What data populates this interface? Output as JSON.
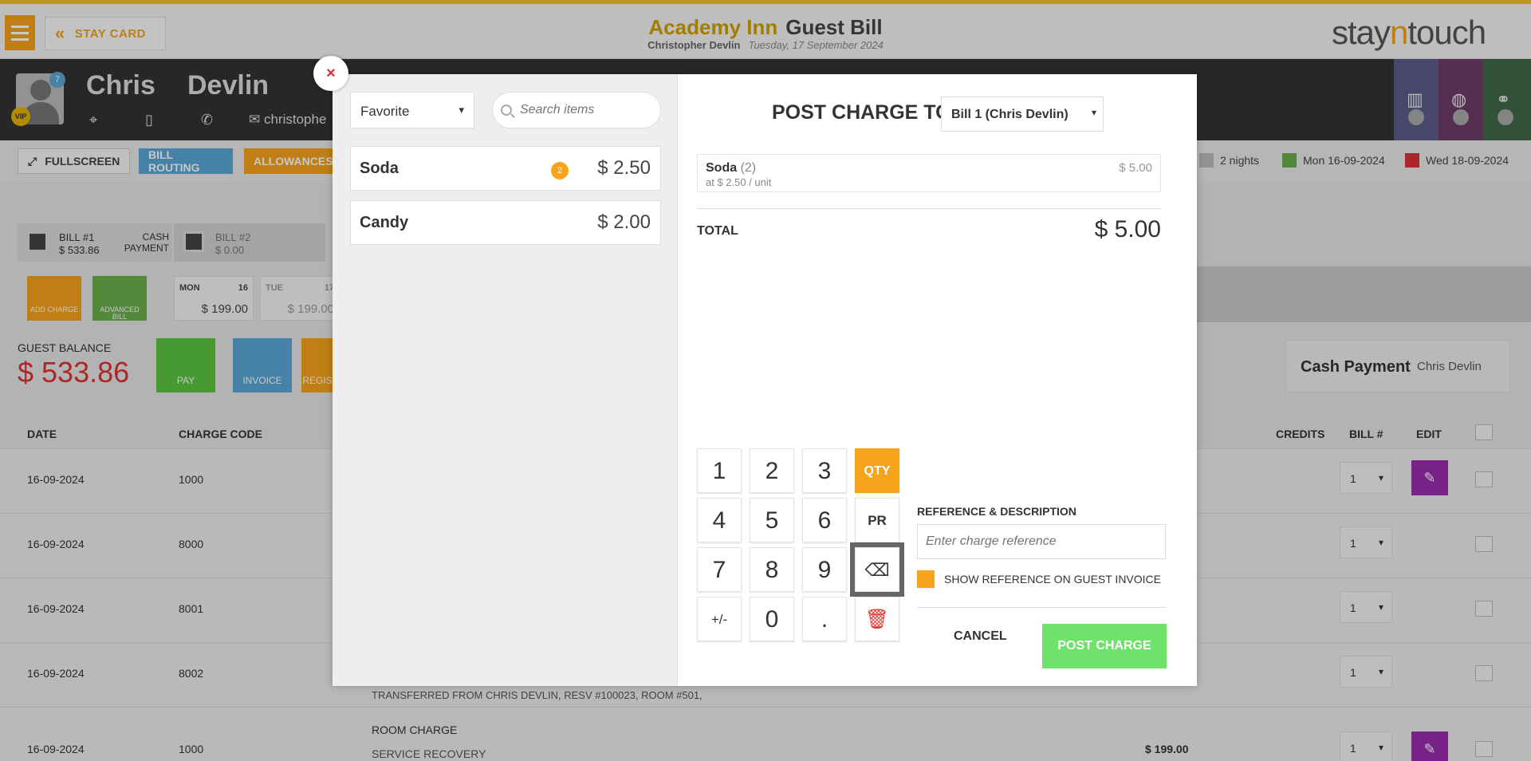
{
  "header": {
    "stay_card": "STAY CARD",
    "hotel": "Academy Inn",
    "page_title": "Guest Bill",
    "guest": "Christopher Devlin",
    "date": "Tuesday, 17 September 2024",
    "brand_a": "stay",
    "brand_b": "n",
    "brand_c": "touch"
  },
  "guest": {
    "first": "Chris",
    "last": "Devlin",
    "badge": "7",
    "vip": "VIP",
    "email": "christophe"
  },
  "actions": {
    "fullscreen": "FULLSCREEN",
    "routing": "BILL ROUTING",
    "allowances": "ALLOWANCES",
    "nights": "2 nights",
    "arrival": "Mon 16-09-2024",
    "departure": "Wed 18-09-2024"
  },
  "bills": {
    "bill1_title": "BILL #1",
    "bill1_amount": "$ 533.86",
    "cash_payment": "CASH PAYMENT",
    "bill2_title": "BILL #2",
    "bill2_amount": "$ 0.00",
    "add_charge": "ADD CHARGE",
    "advanced_bill": "ADVANCED BILL",
    "day1": {
      "day": "MON",
      "num": "16",
      "amount": "$ 199.00"
    },
    "day2": {
      "day": "TUE",
      "num": "17",
      "amount": "$ 199.00"
    },
    "guest_balance_label": "GUEST BALANCE",
    "guest_balance": "$ 533.86",
    "pay": "PAY",
    "invoice": "INVOICE",
    "register": "REGIS",
    "payment_type": "Cash Payment",
    "payer": "Chris Devlin"
  },
  "table": {
    "headers": {
      "date": "DATE",
      "code": "CHARGE CODE",
      "credits": "CREDITS",
      "bill": "BILL #",
      "edit": "EDIT"
    },
    "rows": [
      {
        "date": "16-09-2024",
        "code": "1000",
        "bill": "1"
      },
      {
        "date": "16-09-2024",
        "code": "8000",
        "bill": "1"
      },
      {
        "date": "16-09-2024",
        "code": "8001",
        "bill": "1"
      },
      {
        "date": "16-09-2024",
        "code": "8002",
        "bill": "1",
        "desc2": "TRANSFERRED FROM CHRIS DEVLIN, RESV #100023, ROOM #501,"
      },
      {
        "date": "16-09-2024",
        "code": "1000",
        "bill": "1",
        "desc1": "ROOM CHARGE",
        "desc2": "SERVICE RECOVERY",
        "credit": "$ 199.00"
      }
    ]
  },
  "modal": {
    "close": "×",
    "category": "Favorite",
    "search_placeholder": "Search items",
    "items": [
      {
        "name": "Soda",
        "price": "$ 2.50",
        "qty": "2"
      },
      {
        "name": "Candy",
        "price": "$ 2.00"
      }
    ],
    "post_charge_to": "POST CHARGE TO",
    "bill_option": "Bill 1   (Chris Devlin)",
    "line": {
      "name": "Soda",
      "qty": "(2)",
      "unit": "at $ 2.50 / unit",
      "amount": "$ 5.00"
    },
    "total_label": "TOTAL",
    "total_value": "$ 5.00",
    "keys": {
      "k1": "1",
      "k2": "2",
      "k3": "3",
      "qty": "QTY",
      "k4": "4",
      "k5": "5",
      "k6": "6",
      "pr": "PR",
      "k7": "7",
      "k8": "8",
      "k9": "9",
      "plusminus": "+/-",
      "k0": "0",
      "dot": "."
    },
    "reference_label": "REFERENCE & DESCRIPTION",
    "reference_placeholder": "Enter charge reference",
    "show_reference": "SHOW REFERENCE ON GUEST INVOICE",
    "cancel": "CANCEL",
    "post": "POST CHARGE"
  },
  "colors": {
    "accent": "#f7a31b",
    "brand_gold": "#cfa000",
    "post_green": "#6fe26b",
    "edit_purple": "#9b2db0"
  }
}
